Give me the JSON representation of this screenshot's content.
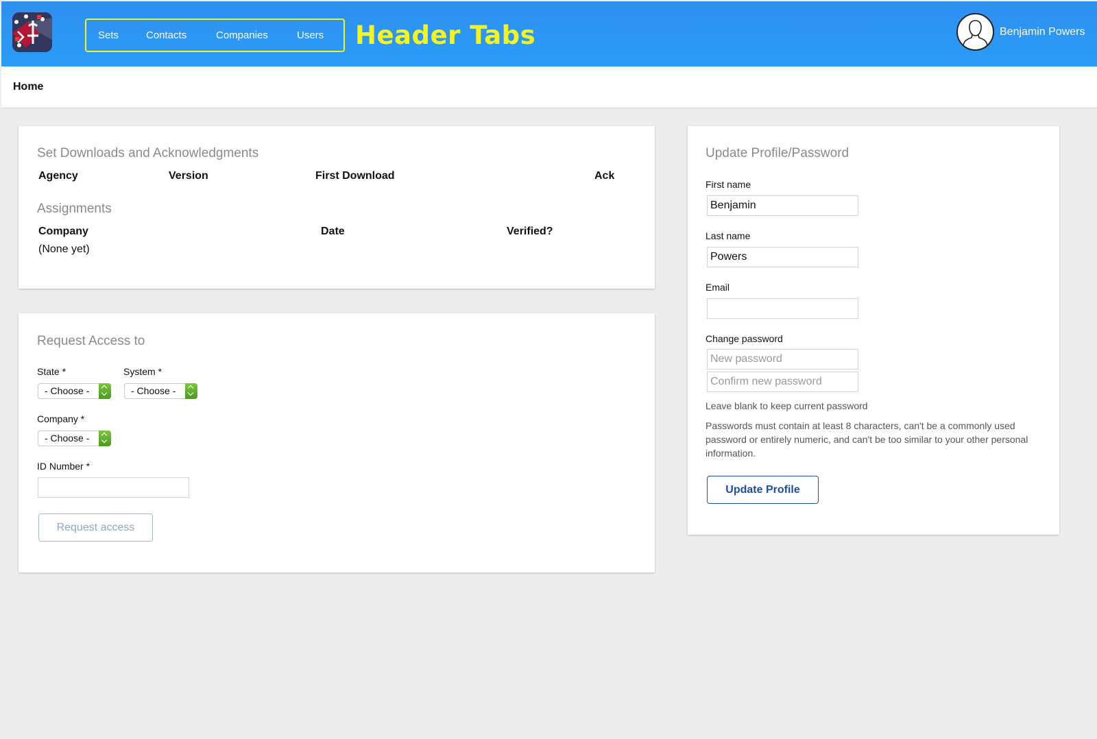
{
  "header": {
    "nav": [
      "Sets",
      "Contacts",
      "Companies",
      "Users"
    ],
    "tabs_title": "Header Tabs",
    "user_name": "Benjamin Powers",
    "colors": {
      "bar": "#2a9df7",
      "highlight": "#f5f51c"
    }
  },
  "breadcrumb": "Home",
  "downloads": {
    "title": "Set Downloads and Acknowledgments",
    "columns": [
      "Agency",
      "Version",
      "First Download",
      "Ack"
    ]
  },
  "assignments": {
    "title": "Assignments",
    "columns": [
      "Company",
      "Date",
      "Verified?"
    ],
    "empty_text": "(None yet)"
  },
  "request": {
    "title": "Request Access to",
    "state_label": "State *",
    "system_label": "System *",
    "company_label": "Company *",
    "id_label": "ID Number *",
    "choose": "- Choose -",
    "id_value": "",
    "button": "Request access"
  },
  "profile": {
    "title": "Update Profile/Password",
    "first_name_label": "First name",
    "first_name": "Benjamin",
    "last_name_label": "Last name",
    "last_name": "Powers",
    "email_label": "Email",
    "email": "",
    "change_password_label": "Change password",
    "new_password_placeholder": "New password",
    "confirm_password_placeholder": "Confirm new password",
    "blank_note": "Leave blank to keep current password",
    "rules": "Passwords must contain at least 8 characters, can't be a commonly used password or entirely numeric, and can't be too similar to your other personal information.",
    "button": "Update Profile"
  }
}
